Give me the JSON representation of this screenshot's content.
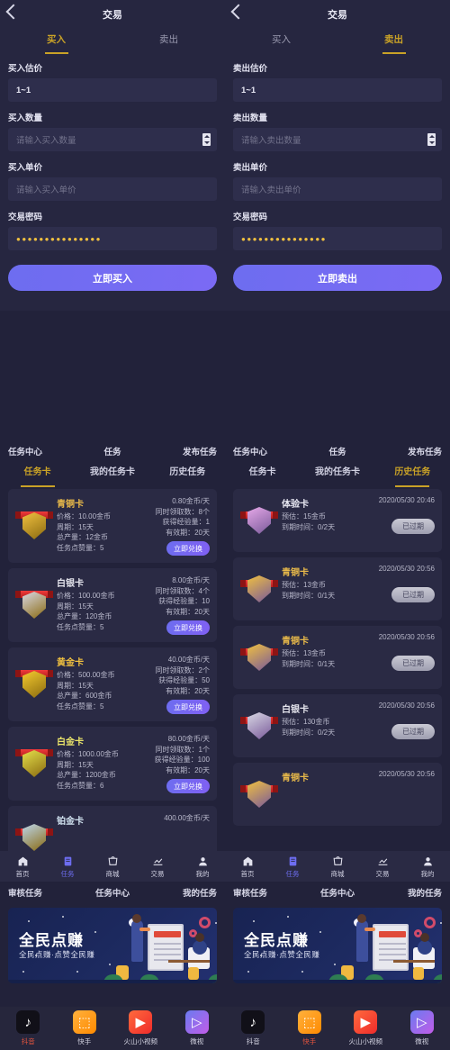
{
  "trade": {
    "left": {
      "title": "交易",
      "back_icon": "chevron-left-icon",
      "tabs": [
        {
          "label": "买入",
          "active": true
        },
        {
          "label": "卖出",
          "active": false
        }
      ],
      "fields": [
        {
          "label": "买入估价",
          "value": "1~1",
          "kind": "value"
        },
        {
          "label": "买入数量",
          "placeholder": "请输入买入数量",
          "kind": "stepper"
        },
        {
          "label": "买入单价",
          "placeholder": "请输入买入单价",
          "kind": "text"
        },
        {
          "label": "交易密码",
          "value": "●●●●●●●●●●●●●●●",
          "kind": "password"
        }
      ],
      "cta": "立即买入"
    },
    "right": {
      "title": "交易",
      "back_icon": "chevron-left-icon",
      "tabs": [
        {
          "label": "买入",
          "active": false
        },
        {
          "label": "卖出",
          "active": true
        }
      ],
      "fields": [
        {
          "label": "卖出估价",
          "value": "1~1",
          "kind": "value"
        },
        {
          "label": "卖出数量",
          "placeholder": "请输入卖出数量",
          "kind": "stepper"
        },
        {
          "label": "卖出单价",
          "placeholder": "请输入卖出单价",
          "kind": "text"
        },
        {
          "label": "交易密码",
          "value": "●●●●●●●●●●●●●●●",
          "kind": "password"
        }
      ],
      "cta": "立即卖出"
    }
  },
  "task": {
    "left": {
      "header": {
        "left": "任务中心",
        "center": "任务",
        "right": "发布任务"
      },
      "tabs": [
        {
          "label": "任务卡",
          "active": true
        },
        {
          "label": "我的任务卡",
          "active": false
        },
        {
          "label": "历史任务",
          "active": false
        }
      ],
      "cards": [
        {
          "name": "青铜卡",
          "name_color": "#e8b94a",
          "badge_color": "#f0c040",
          "lines": [
            "价格：10.00金币",
            "周期：15天",
            "总产量：12金币",
            "任务点赞量：5"
          ],
          "right_lines": [
            "0.80金币/天",
            "同时领取数：8个",
            "获得经验量：1",
            "有效期：20天"
          ],
          "button": "立即兑换"
        },
        {
          "name": "白银卡",
          "name_color": "#e6e6ee",
          "badge_color": "#d8d8e4",
          "lines": [
            "价格：100.00金币",
            "周期：15天",
            "总产量：120金币",
            "任务点赞量：5"
          ],
          "right_lines": [
            "8.00金币/天",
            "同时领取数：4个",
            "获得经验量：10",
            "有效期：20天"
          ],
          "button": "立即兑换"
        },
        {
          "name": "黄金卡",
          "name_color": "#f0c040",
          "badge_color": "#f5cb2e",
          "lines": [
            "价格：500.00金币",
            "周期：15天",
            "总产量：600金币",
            "任务点赞量：5"
          ],
          "right_lines": [
            "40.00金币/天",
            "同时领取数：2个",
            "获得经验量：50",
            "有效期：20天"
          ],
          "button": "立即兑换"
        },
        {
          "name": "白金卡",
          "name_color": "#e9e36a",
          "badge_color": "#e4e04a",
          "lines": [
            "价格：1000.00金币",
            "周期：15天",
            "总产量：1200金币",
            "任务点赞量：6"
          ],
          "right_lines": [
            "80.00金币/天",
            "同时领取数：1个",
            "获得经验量：100",
            "有效期：20天"
          ],
          "button": "立即兑换"
        },
        {
          "name": "铂金卡",
          "name_color": "#cfe0ee",
          "badge_color": "#bcd6ea",
          "lines": [],
          "right_lines": [
            "400.00金币/天"
          ],
          "button": ""
        }
      ]
    },
    "right": {
      "header": {
        "left": "任务中心",
        "center": "任务",
        "right": "发布任务"
      },
      "tabs": [
        {
          "label": "任务卡",
          "active": false
        },
        {
          "label": "我的任务卡",
          "active": false
        },
        {
          "label": "历史任务",
          "active": true
        }
      ],
      "cards": [
        {
          "name": "体验卡",
          "name_color": "#e8e8f2",
          "badge_color": "#e6a8e8",
          "date": "2020/05/30 20:46",
          "lines": [
            "预估：15金币",
            "到期时间：0/2天"
          ],
          "status": "已过期"
        },
        {
          "name": "青铜卡",
          "name_color": "#e8b94a",
          "badge_color": "#f0c040",
          "date": "2020/05/30 20:56",
          "lines": [
            "预估：13金币",
            "到期时间：0/1天"
          ],
          "status": "已过期"
        },
        {
          "name": "青铜卡",
          "name_color": "#e8b94a",
          "badge_color": "#f0c040",
          "date": "2020/05/30 20:56",
          "lines": [
            "预估：13金币",
            "到期时间：0/1天"
          ],
          "status": "已过期"
        },
        {
          "name": "白银卡",
          "name_color": "#e6e6ee",
          "badge_color": "#d8d8e4",
          "date": "2020/05/30 20:56",
          "lines": [
            "预估：130金币",
            "到期时间：0/2天"
          ],
          "status": "已过期"
        },
        {
          "name": "青铜卡",
          "name_color": "#e8b94a",
          "badge_color": "#f0c040",
          "date": "2020/05/30 20:56",
          "lines": [],
          "status": ""
        }
      ]
    }
  },
  "bottom_nav": {
    "items": [
      {
        "label": "首页",
        "icon": "home-icon",
        "active": false
      },
      {
        "label": "任务",
        "icon": "tasklist-icon",
        "active": true
      },
      {
        "label": "商城",
        "icon": "shop-bag-icon",
        "active": false
      },
      {
        "label": "交易",
        "icon": "chart-trend-icon",
        "active": false
      },
      {
        "label": "我的",
        "icon": "person-icon",
        "active": false
      }
    ]
  },
  "home": {
    "header": {
      "left": "审核任务",
      "center": "任务中心",
      "right": "我的任务"
    },
    "banner": {
      "title": "全民点赚",
      "subtitle": "全民点赚·点赞全民赚"
    },
    "apps_left": [
      {
        "label": "抖音",
        "icon": "douyin-icon",
        "active": true
      },
      {
        "label": "快手",
        "icon": "kuaishou-icon",
        "active": false
      },
      {
        "label": "火山小视频",
        "icon": "huoshan-icon",
        "active": false
      },
      {
        "label": "微视",
        "icon": "weishi-icon",
        "active": false
      }
    ],
    "apps_right": [
      {
        "label": "抖音",
        "icon": "douyin-icon",
        "active": false
      },
      {
        "label": "快手",
        "icon": "kuaishou-icon",
        "active": true
      },
      {
        "label": "火山小视频",
        "icon": "huoshan-icon",
        "active": false
      },
      {
        "label": "微视",
        "icon": "weishi-icon",
        "active": false
      }
    ]
  },
  "colors": {
    "background": "#22223a",
    "panel": "#262640",
    "card": "#2a2a44",
    "accent_gold": "#c9a227",
    "accent_purple": "#6d6df0",
    "text_primary": "#e8e8f4",
    "text_muted": "#b9b9cc"
  }
}
